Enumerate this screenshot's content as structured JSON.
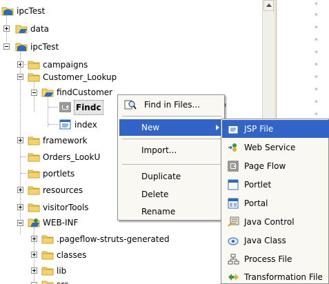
{
  "tree": {
    "items": [
      {
        "label": "ipcTest"
      },
      {
        "label": "data"
      },
      {
        "label": "ipcTest"
      },
      {
        "label": "campaigns"
      },
      {
        "label": "Customer_Lookup"
      },
      {
        "label": "findCustomer"
      },
      {
        "label": "Findc"
      },
      {
        "label": "index"
      },
      {
        "label": "framework"
      },
      {
        "label": "Orders_LookU"
      },
      {
        "label": "portlets"
      },
      {
        "label": "resources"
      },
      {
        "label": "visitorTools"
      },
      {
        "label": "WEB-INF"
      },
      {
        "label": ".pageflow-struts-generated"
      },
      {
        "label": "classes"
      },
      {
        "label": "lib"
      },
      {
        "label": "src"
      }
    ],
    "selected_suffix": "f"
  },
  "context_menu": {
    "find_in_files": "Find in Files...",
    "new": "New",
    "import": "Import...",
    "duplicate": "Duplicate",
    "delete": "Delete",
    "rename": "Rename"
  },
  "submenu": {
    "items": [
      {
        "label": "JSP File",
        "icon": "jsp-file-icon"
      },
      {
        "label": "Web Service",
        "icon": "web-service-icon"
      },
      {
        "label": "Page Flow",
        "icon": "page-flow-icon"
      },
      {
        "label": "Portlet",
        "icon": "portlet-icon"
      },
      {
        "label": "Portal",
        "icon": "portal-icon"
      },
      {
        "label": "Java Control",
        "icon": "java-control-icon"
      },
      {
        "label": "Java Class",
        "icon": "java-class-icon"
      },
      {
        "label": "Process File",
        "icon": "process-file-icon"
      },
      {
        "label": "Transformation File",
        "icon": "transformation-file-icon"
      }
    ]
  },
  "gutter": {
    "marker": "*"
  },
  "colors": {
    "highlight": "#3264c8",
    "folder": "#f2d46b",
    "folder_dark": "#c9a233",
    "project": "#2e6bb8"
  }
}
